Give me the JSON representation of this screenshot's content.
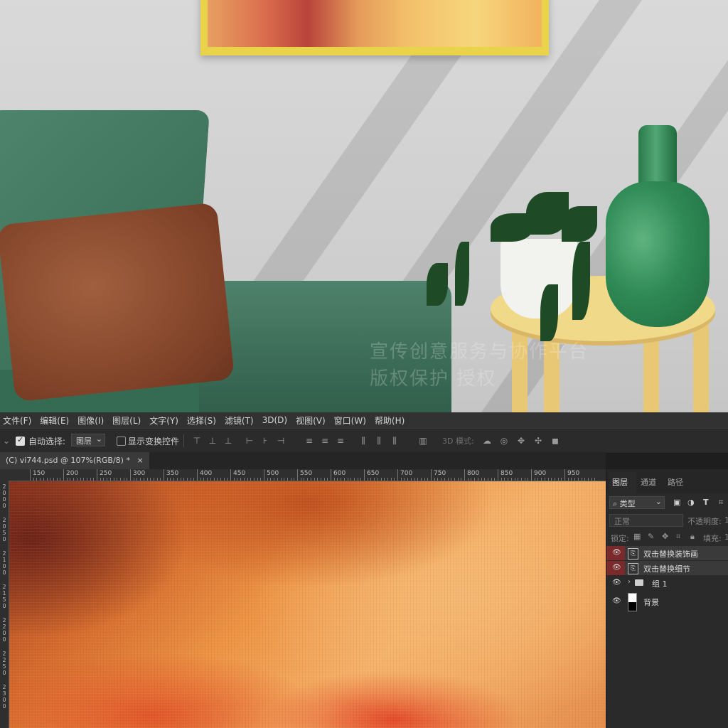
{
  "menubar": {
    "items": [
      "文件(F)",
      "编辑(E)",
      "图像(I)",
      "图层(L)",
      "文字(Y)",
      "选择(S)",
      "滤镜(T)",
      "3D(D)",
      "视图(V)",
      "窗口(W)",
      "帮助(H)"
    ]
  },
  "options": {
    "auto_select_label": "自动选择:",
    "auto_select_target": "图层",
    "show_transform_label": "显示变换控件",
    "mode_3d_label": "3D 模式:"
  },
  "document_tab": {
    "label": "(C) vi744.psd @ 107%(RGB/8) *",
    "close": "×"
  },
  "ruler": {
    "h_labels": [
      "150",
      "200",
      "250",
      "300",
      "350",
      "400",
      "450",
      "500",
      "550",
      "600",
      "650",
      "700",
      "750",
      "800",
      "850",
      "900",
      "950"
    ],
    "v_labels": [
      "2000",
      "2050",
      "2100",
      "2150",
      "2200",
      "2250",
      "2300"
    ]
  },
  "scene": {
    "watermark_line1": "宣传创意服务与协作平台",
    "watermark_line2": "版权保护 授权"
  },
  "layers_panel": {
    "tabs": [
      "图层",
      "通道",
      "路径"
    ],
    "filter_label": "类型",
    "blend_mode": "正常",
    "opacity_label": "不透明度:",
    "opacity_value": "1",
    "lock_label": "锁定:",
    "fill_label": "填充:",
    "fill_value": "1",
    "layers": [
      {
        "name": "双击替换装饰画",
        "kind": "smart"
      },
      {
        "name": "双击替换细节",
        "kind": "smart"
      },
      {
        "name": "组 1",
        "kind": "group"
      },
      {
        "name": "背景",
        "kind": "background"
      }
    ]
  }
}
